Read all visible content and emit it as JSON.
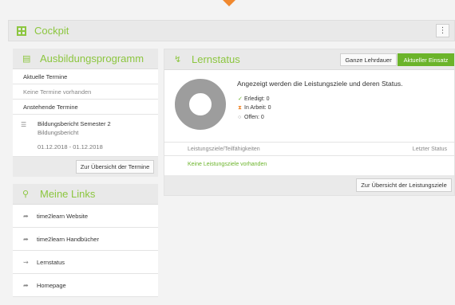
{
  "cockpit": {
    "title": "Cockpit",
    "menu_icon": "kebab-menu-icon"
  },
  "ausbildung": {
    "title": "Ausbildungsprogramm",
    "icon": "calendar-icon",
    "aktuelle_label": "Aktuelle Termine",
    "keine_label": "Keine Termine vorhanden",
    "anstehende_label": "Anstehende Termine",
    "bericht_title": "Bildungsbericht Semester 2",
    "bericht_type": "Bildungsbericht",
    "bericht_dates": "01.12.2018 - 01.12.2018",
    "overview_button": "Zur Übersicht der Termine"
  },
  "links": {
    "title": "Meine Links",
    "icon": "link-icon",
    "items": [
      {
        "label": "time2learn Website",
        "icon": "share-arrow-icon"
      },
      {
        "label": "time2learn Handbücher",
        "icon": "share-arrow-icon"
      },
      {
        "label": "Lernstatus",
        "icon": "route-icon"
      },
      {
        "label": "Homepage",
        "icon": "share-arrow-icon"
      }
    ]
  },
  "lernstatus": {
    "title": "Lernstatus",
    "icon": "status-icon",
    "tabs": [
      "Ganze Lehrdauer",
      "Aktueller Einsatz"
    ],
    "active_tab": "Aktueller Einsatz",
    "description": "Angezeigt werden die Leistungsziele und deren Status.",
    "stats": [
      {
        "label": "Erledigt:",
        "value": "0",
        "icon": "check-icon"
      },
      {
        "label": "In Arbeit:",
        "value": "0",
        "icon": "hourglass-icon"
      },
      {
        "label": "Offen:",
        "value": "0",
        "icon": "circle-icon"
      }
    ],
    "col_goals": "Leistungsziele/Teilfähigkeiten",
    "col_status": "Letzter Status",
    "empty_text": "Keine Leistungsziele vorhanden",
    "overview_button": "Zur Übersicht der Leistungsziele"
  },
  "colors": {
    "accent": "#8cc63f",
    "active_tab": "#6bb42a",
    "warning": "#f0882e"
  }
}
